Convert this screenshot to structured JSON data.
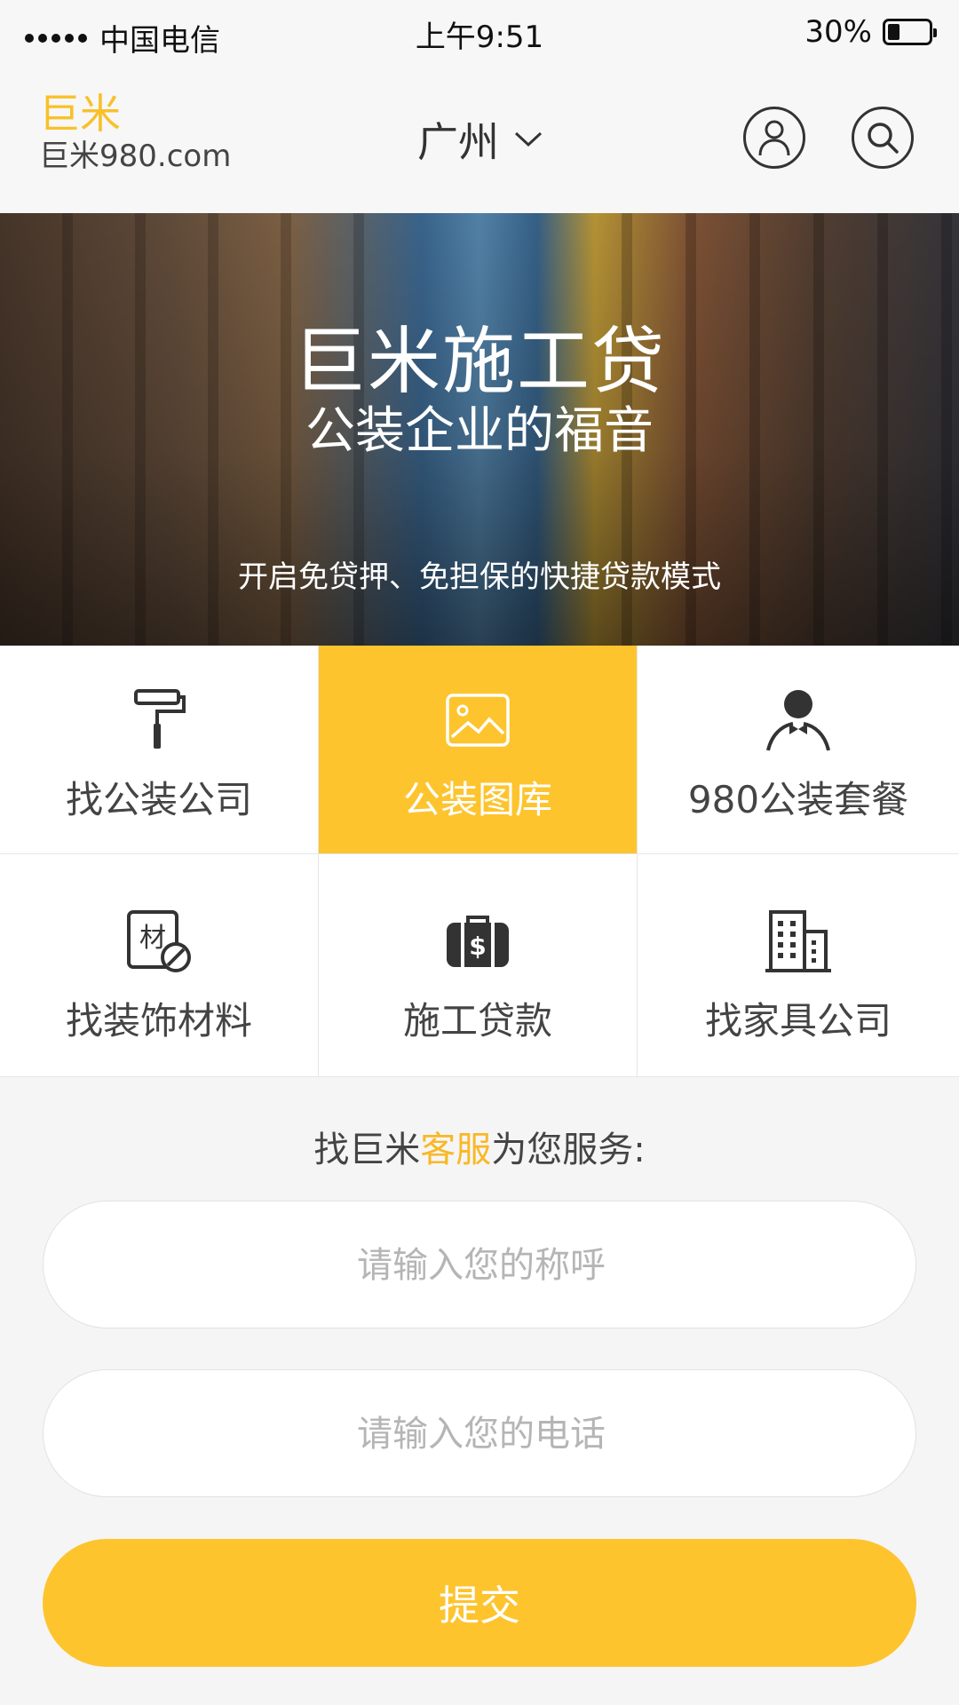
{
  "status_bar": {
    "carrier": "中国电信",
    "time": "上午9:51",
    "battery": "30%",
    "battery_level": 0.3
  },
  "header": {
    "logo_title": "巨米",
    "logo_subtitle": "巨米980.com",
    "city": "广州"
  },
  "banner": {
    "title": "巨米施工贷",
    "subtitle": "公装企业的福音",
    "tagline": "开启免贷押、免担保的快捷贷款模式"
  },
  "categories": [
    {
      "label": "找公装公司",
      "icon": "paint-roller-icon",
      "active": false
    },
    {
      "label": "公装图库",
      "icon": "picture-icon",
      "active": true
    },
    {
      "label": "980公装套餐",
      "icon": "butler-icon",
      "active": false
    },
    {
      "label": "找装饰材料",
      "icon": "material-icon",
      "active": false
    },
    {
      "label": "施工贷款",
      "icon": "money-bag-icon",
      "active": false
    },
    {
      "label": "找家具公司",
      "icon": "building-icon",
      "active": false
    }
  ],
  "service": {
    "prefix": "找巨米",
    "highlight": "客服",
    "suffix": "为您服务:"
  },
  "form": {
    "name_placeholder": "请输入您的称呼",
    "phone_placeholder": "请输入您的电话",
    "submit_label": "提交"
  },
  "colors": {
    "accent": "#fdc42e",
    "logo": "#f8c12a"
  }
}
